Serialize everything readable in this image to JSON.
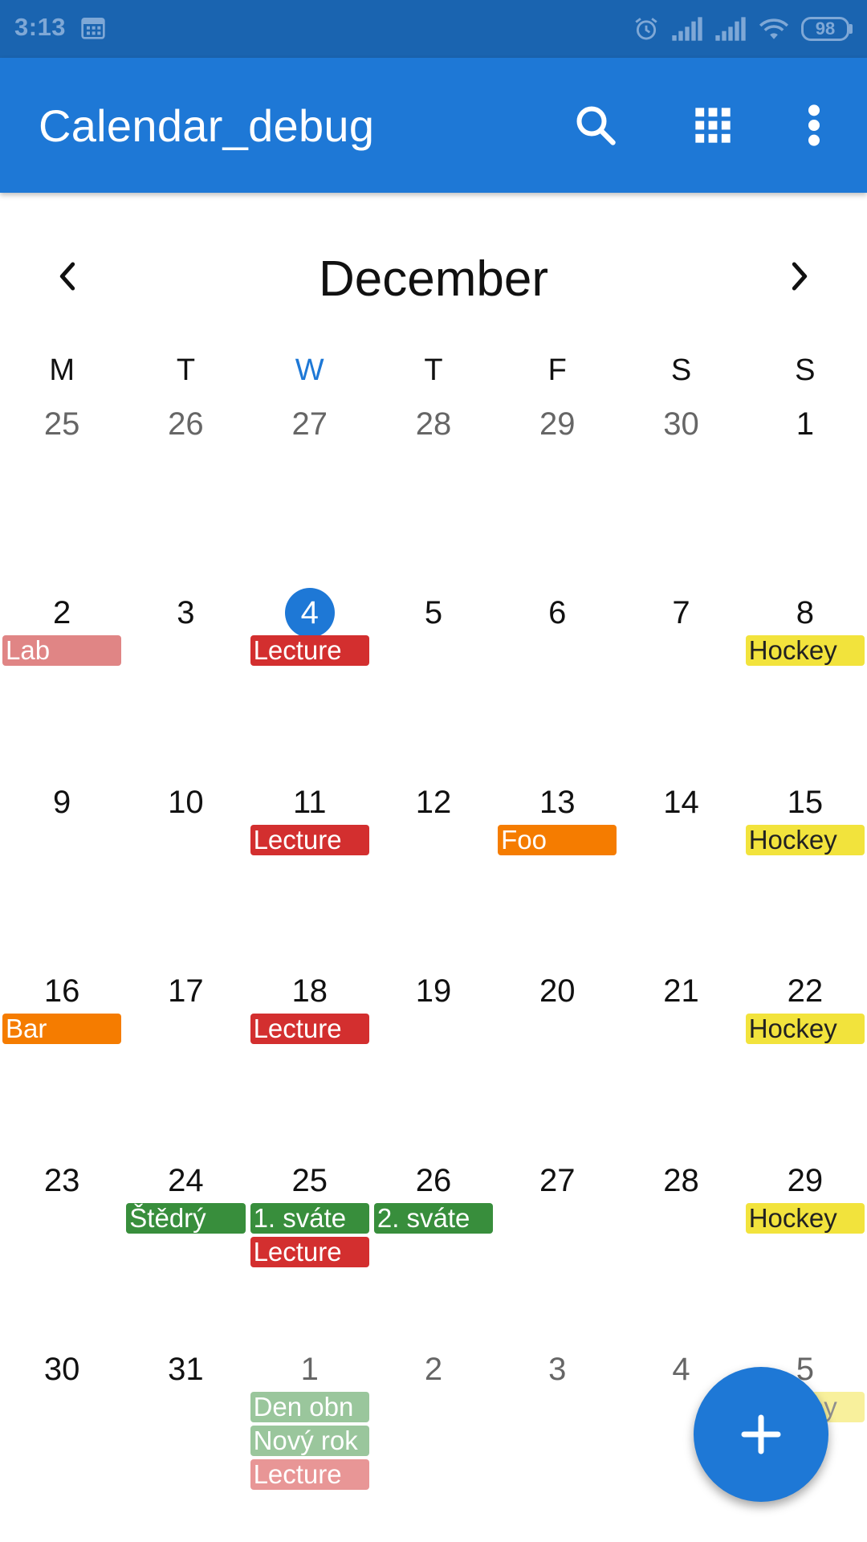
{
  "status_bar": {
    "time": "3:13",
    "battery": "98"
  },
  "app_bar": {
    "title": "Calendar_debug",
    "actions": [
      "search-icon",
      "apps-grid-icon",
      "more-vert-icon"
    ]
  },
  "month_header": {
    "title": "December"
  },
  "weekdays": [
    "M",
    "T",
    "W",
    "T",
    "F",
    "S",
    "S"
  ],
  "current_weekday_index": 2,
  "colors": {
    "primary": "#1e78d6",
    "status_bar": "#1a64b0",
    "event_red": "#d32f2f",
    "event_pink": "#e57373",
    "event_orange": "#f57c00",
    "event_yellow": "#f2e33c",
    "event_green": "#388e3c"
  },
  "weeks": [
    {
      "days": [
        {
          "num": "25",
          "other": true,
          "events": []
        },
        {
          "num": "26",
          "other": true,
          "events": []
        },
        {
          "num": "27",
          "other": true,
          "events": []
        },
        {
          "num": "28",
          "other": true,
          "events": []
        },
        {
          "num": "29",
          "other": true,
          "events": []
        },
        {
          "num": "30",
          "other": true,
          "events": []
        },
        {
          "num": "1",
          "other": false,
          "events": []
        }
      ]
    },
    {
      "days": [
        {
          "num": "2",
          "other": false,
          "events": [
            {
              "title": "Lab",
              "color": "#e08585"
            }
          ]
        },
        {
          "num": "3",
          "other": false,
          "events": []
        },
        {
          "num": "4",
          "other": false,
          "today": true,
          "events": [
            {
              "title": "Lecture",
              "color": "#d32f2f"
            }
          ]
        },
        {
          "num": "5",
          "other": false,
          "events": []
        },
        {
          "num": "6",
          "other": false,
          "events": []
        },
        {
          "num": "7",
          "other": false,
          "events": []
        },
        {
          "num": "8",
          "other": false,
          "events": [
            {
              "title": "Hockey",
              "color": "#f2e33c",
              "dark_text": true
            }
          ]
        }
      ]
    },
    {
      "days": [
        {
          "num": "9",
          "other": false,
          "events": []
        },
        {
          "num": "10",
          "other": false,
          "events": []
        },
        {
          "num": "11",
          "other": false,
          "events": [
            {
              "title": "Lecture",
              "color": "#d32f2f"
            }
          ]
        },
        {
          "num": "12",
          "other": false,
          "events": []
        },
        {
          "num": "13",
          "other": false,
          "events": [
            {
              "title": "Foo",
              "color": "#f57c00"
            }
          ]
        },
        {
          "num": "14",
          "other": false,
          "events": []
        },
        {
          "num": "15",
          "other": false,
          "events": [
            {
              "title": "Hockey",
              "color": "#f2e33c",
              "dark_text": true
            }
          ]
        }
      ]
    },
    {
      "days": [
        {
          "num": "16",
          "other": false,
          "events": [
            {
              "title": "Bar",
              "color": "#f57c00"
            }
          ]
        },
        {
          "num": "17",
          "other": false,
          "events": []
        },
        {
          "num": "18",
          "other": false,
          "events": [
            {
              "title": "Lecture",
              "color": "#d32f2f"
            }
          ]
        },
        {
          "num": "19",
          "other": false,
          "events": []
        },
        {
          "num": "20",
          "other": false,
          "events": []
        },
        {
          "num": "21",
          "other": false,
          "events": []
        },
        {
          "num": "22",
          "other": false,
          "events": [
            {
              "title": "Hockey",
              "color": "#f2e33c",
              "dark_text": true
            }
          ]
        }
      ]
    },
    {
      "days": [
        {
          "num": "23",
          "other": false,
          "events": []
        },
        {
          "num": "24",
          "other": false,
          "events": [
            {
              "title": "Štědrý",
              "color": "#388e3c"
            }
          ]
        },
        {
          "num": "25",
          "other": false,
          "events": [
            {
              "title": "1. sváte",
              "color": "#388e3c"
            },
            {
              "title": "Lecture",
              "color": "#d32f2f"
            }
          ]
        },
        {
          "num": "26",
          "other": false,
          "events": [
            {
              "title": "2. sváte",
              "color": "#388e3c"
            }
          ]
        },
        {
          "num": "27",
          "other": false,
          "events": []
        },
        {
          "num": "28",
          "other": false,
          "events": []
        },
        {
          "num": "29",
          "other": false,
          "events": [
            {
              "title": "Hockey",
              "color": "#f2e33c",
              "dark_text": true
            }
          ]
        }
      ]
    },
    {
      "days": [
        {
          "num": "30",
          "other": false,
          "events": []
        },
        {
          "num": "31",
          "other": false,
          "events": []
        },
        {
          "num": "1",
          "other": true,
          "events": [
            {
              "title": "Den obn",
              "color": "#388e3c"
            },
            {
              "title": "Nový rok",
              "color": "#388e3c"
            },
            {
              "title": "Lecture",
              "color": "#d32f2f"
            }
          ]
        },
        {
          "num": "2",
          "other": true,
          "events": []
        },
        {
          "num": "3",
          "other": true,
          "events": []
        },
        {
          "num": "4",
          "other": true,
          "events": []
        },
        {
          "num": "5",
          "other": true,
          "events": [
            {
              "title": "Hockey",
              "color": "#f2e33c",
              "dark_text": true
            }
          ]
        }
      ]
    }
  ],
  "fab": {
    "icon": "add-icon"
  }
}
